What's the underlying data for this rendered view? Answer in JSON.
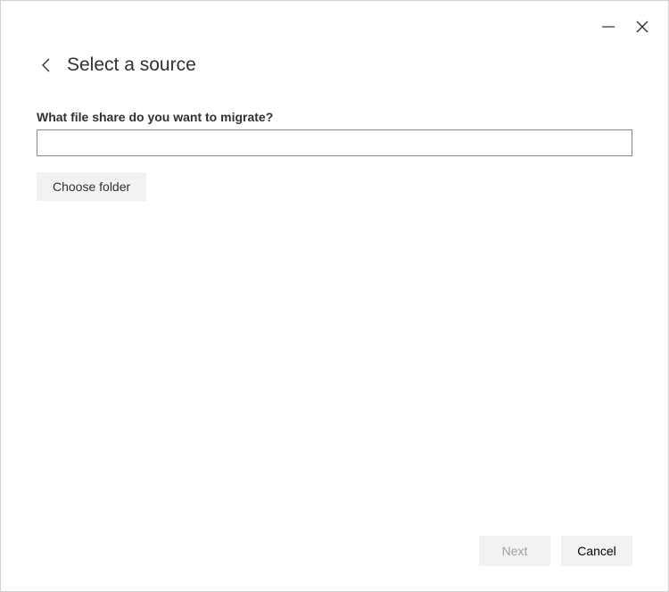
{
  "header": {
    "title": "Select a source"
  },
  "form": {
    "file_share_label": "What file share do you want to migrate?",
    "file_share_value": "",
    "choose_folder_label": "Choose folder"
  },
  "footer": {
    "next_label": "Next",
    "cancel_label": "Cancel"
  }
}
